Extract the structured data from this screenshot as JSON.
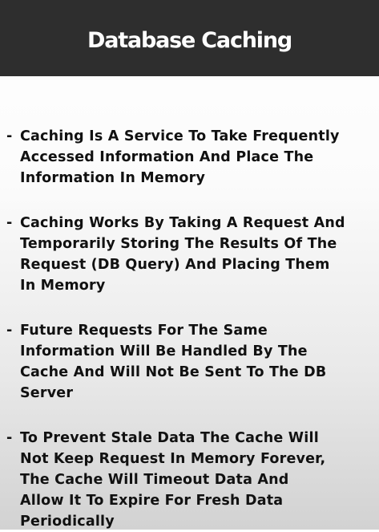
{
  "slide": {
    "title": "Database Caching",
    "bullets": [
      {
        "marker": "-",
        "lines": [
          "Caching Is A Service To Take Frequently",
          "Accessed Information And Place The",
          "Information In Memory"
        ]
      },
      {
        "marker": "-",
        "lines": [
          "Caching Works By Taking A Request And",
          "Temporarily Storing The Results Of The",
          "Request (DB Query) And Placing Them",
          "In Memory"
        ]
      },
      {
        "marker": "-",
        "lines": [
          "Future Requests For The Same",
          "Information Will Be Handled By The",
          "Cache And Will Not Be Sent To The DB",
          "Server"
        ]
      },
      {
        "marker": "-",
        "lines": [
          "To Prevent Stale Data The Cache Will",
          "Not Keep Request In Memory Forever,",
          "The Cache Will Timeout Data And",
          "Allow It To Expire For Fresh Data",
          "Periodically"
        ]
      }
    ]
  },
  "colors": {
    "header_bg": "#2e2e2e",
    "title_text": "#ffffff",
    "body_text": "#111111"
  }
}
